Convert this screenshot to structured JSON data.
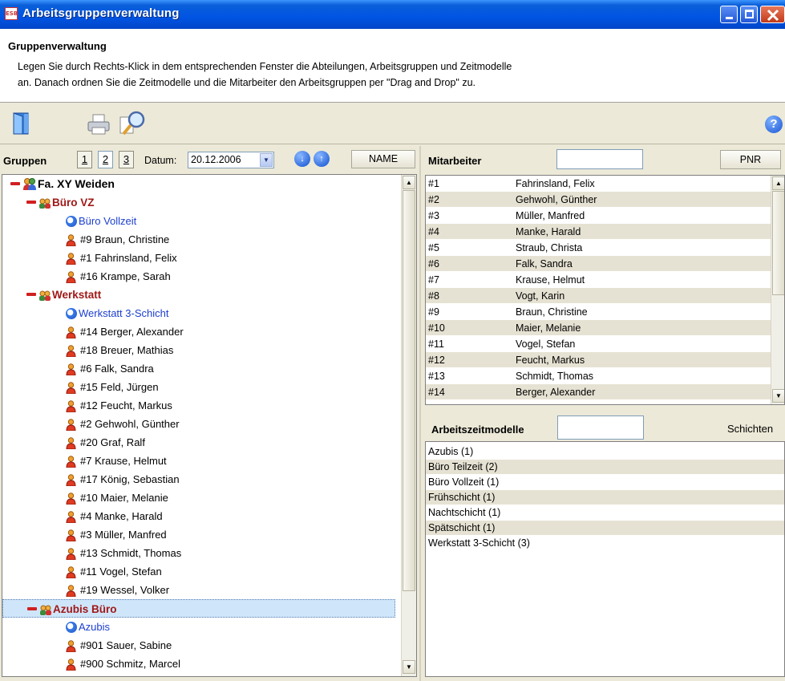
{
  "window": {
    "title": "Arbeitsgruppenverwaltung",
    "app_badge": "ESB"
  },
  "header": {
    "heading": "Gruppenverwaltung",
    "line1": "Legen Sie durch Rechts-Klick in dem entsprechenden Fenster die Abteilungen, Arbeitsgruppen und Zeitmodelle",
    "line2": "an. Danach ordnen Sie die Zeitmodelle und die Mitarbeiter den Arbeitsgruppen per \"Drag and Drop\" zu."
  },
  "toolbar": {
    "help_label": "?"
  },
  "groups_panel": {
    "label": "Gruppen",
    "pages": [
      "1",
      "2",
      "3"
    ],
    "date_label": "Datum:",
    "date_value": "20.12.2006",
    "combo_arrow": "▼",
    "down_arrow": "↓",
    "up_arrow": "↑",
    "sort_button": "NAME",
    "tree": {
      "root": "Fa. XY Weiden",
      "departments": [
        {
          "name": "Büro VZ",
          "model": "Büro Vollzeit",
          "employees": [
            "#9 Braun, Christine",
            "#1 Fahrinsland, Felix",
            "#16 Krampe, Sarah"
          ]
        },
        {
          "name": "Werkstatt",
          "model": "Werkstatt 3-Schicht",
          "employees": [
            "#14 Berger, Alexander",
            "#18 Breuer, Mathias",
            "#6 Falk, Sandra",
            "#15 Feld, Jürgen",
            "#12 Feucht, Markus",
            "#2 Gehwohl, Günther",
            "#20 Graf, Ralf",
            "#7 Krause, Helmut",
            "#17 König, Sebastian",
            "#10 Maier, Melanie",
            "#4 Manke, Harald",
            "#3 Müller, Manfred",
            "#13 Schmidt, Thomas",
            "#11 Vogel, Stefan",
            "#19 Wessel, Volker"
          ]
        },
        {
          "name": "Azubis Büro",
          "model": "Azubis",
          "employees": [
            "#901 Sauer, Sabine",
            "#900 Schmitz, Marcel"
          ]
        }
      ]
    }
  },
  "employees_panel": {
    "label": "Mitarbeiter",
    "search_value": "",
    "sort_button": "PNR",
    "rows": [
      {
        "pnr": "#1",
        "name": "Fahrinsland, Felix"
      },
      {
        "pnr": "#2",
        "name": "Gehwohl, Günther"
      },
      {
        "pnr": "#3",
        "name": "Müller, Manfred"
      },
      {
        "pnr": "#4",
        "name": "Manke, Harald"
      },
      {
        "pnr": "#5",
        "name": "Straub, Christa"
      },
      {
        "pnr": "#6",
        "name": "Falk, Sandra"
      },
      {
        "pnr": "#7",
        "name": "Krause, Helmut"
      },
      {
        "pnr": "#8",
        "name": "Vogt, Karin"
      },
      {
        "pnr": "#9",
        "name": "Braun, Christine"
      },
      {
        "pnr": "#10",
        "name": "Maier, Melanie"
      },
      {
        "pnr": "#11",
        "name": "Vogel, Stefan"
      },
      {
        "pnr": "#12",
        "name": "Feucht, Markus"
      },
      {
        "pnr": "#13",
        "name": "Schmidt, Thomas"
      },
      {
        "pnr": "#14",
        "name": "Berger, Alexander"
      }
    ]
  },
  "models_panel": {
    "label": "Arbeitszeitmodelle",
    "search_value": "",
    "shifts_label": "Schichten",
    "rows": [
      "Azubis (1)",
      "Büro Teilzeit (2)",
      "Büro Vollzeit (1)",
      "Frühschicht (1)",
      "Nachtschicht (1)",
      "Spätschicht (1)",
      "Werkstatt 3-Schicht (3)"
    ]
  },
  "colors": {
    "title_bar": "#0054e3",
    "group_text": "#a01818",
    "model_text": "#1c3fcf",
    "selection": "#cfe6fa",
    "alt_row": "#e6e2d3"
  }
}
